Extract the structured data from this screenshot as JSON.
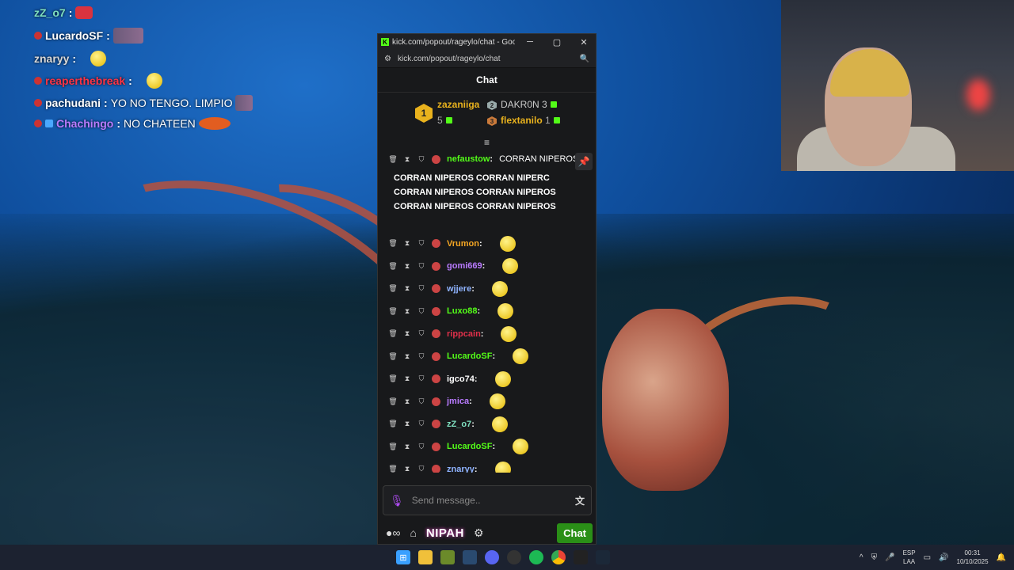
{
  "overlay_chat": [
    {
      "user": "zZ_o7",
      "text": "",
      "color": "#7fe0c0"
    },
    {
      "user": "LucardoSF",
      "text": "",
      "color": "#ffffff"
    },
    {
      "user": "znaryy",
      "text": "",
      "color": "#d8d8d8"
    },
    {
      "user": "reaperthebreak",
      "text": "",
      "color": "#ff3344"
    },
    {
      "user": "pachudani",
      "text": "YO NO TENGO. LIMPIO",
      "color": "#ffffff"
    },
    {
      "user": "Chachingo",
      "text": "NO CHATEEN",
      "color": "#b97bff"
    }
  ],
  "window": {
    "title": "kick.com/popout/rageylo/chat - Google Chro...",
    "url": "kick.com/popout/rageylo/chat",
    "minimize": "─",
    "maximize": "▢",
    "close": "✕"
  },
  "chat": {
    "header": "Chat",
    "leaderboard": {
      "first": {
        "rank": "1",
        "name": "zazaniiga",
        "count": "5"
      },
      "second": {
        "rank": "2",
        "name": "DAKR0N",
        "count": "3"
      },
      "third": {
        "rank": "3",
        "name": "flextanilo",
        "count": "1"
      }
    },
    "pinned": {
      "user": "nefaustow",
      "lines": [
        "CORRAN NIPEROS",
        "CORRAN NIPEROS    CORRAN NIPERC",
        "CORRAN NIPEROS    CORRAN NIPEROS",
        "CORRAN NIPEROS    CORRAN NIPEROS"
      ]
    },
    "messages": [
      {
        "user": "Vrumon",
        "color": "#f5a623"
      },
      {
        "user": "gomi669",
        "color": "#b97bff"
      },
      {
        "user": "wjjere",
        "color": "#8fb3ff"
      },
      {
        "user": "Luxo88",
        "color": "#53fc18"
      },
      {
        "user": "rippcain",
        "color": "#e0304a"
      },
      {
        "user": "LucardoSF",
        "color": "#53fc18"
      },
      {
        "user": "igco74",
        "color": "#ffffff"
      },
      {
        "user": "jmica",
        "color": "#b97bff"
      },
      {
        "user": "zZ_o7",
        "color": "#7fe0c0"
      },
      {
        "user": "LucardoSF",
        "color": "#53fc18"
      },
      {
        "user": "znaryy",
        "color": "#8fb3ff"
      }
    ],
    "input_placeholder": "Send message..",
    "brand": "NIPAH",
    "send_label": "Chat",
    "pin_icon": "📌"
  },
  "taskbar": {
    "lang_top": "ESP",
    "lang_bottom": "LAA",
    "time": "00:31",
    "date": "10/10/2025"
  }
}
